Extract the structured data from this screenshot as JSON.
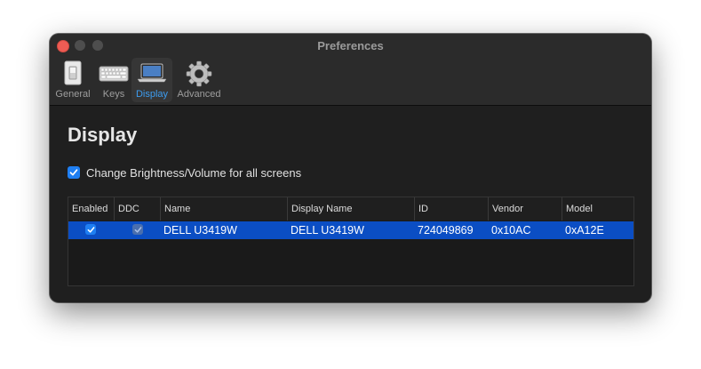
{
  "window": {
    "title": "Preferences"
  },
  "tabs": [
    {
      "label": "General",
      "icon": "light-switch-icon"
    },
    {
      "label": "Keys",
      "icon": "keyboard-icon"
    },
    {
      "label": "Display",
      "icon": "laptop-display-icon",
      "selected": true
    },
    {
      "label": "Advanced",
      "icon": "gear-icon"
    }
  ],
  "content": {
    "heading": "Display",
    "brightness_checkbox": {
      "label": "Change Brightness/Volume for all screens",
      "checked": true
    }
  },
  "table": {
    "columns": [
      "Enabled",
      "DDC",
      "Name",
      "Display Name",
      "ID",
      "Vendor",
      "Model"
    ],
    "rows": [
      {
        "enabled": true,
        "ddc": true,
        "name": "DELL U3419W",
        "display_name": "DELL U3419W",
        "id": "724049869",
        "vendor": "0x10AC",
        "model": "0xA12E",
        "selected": true
      }
    ]
  },
  "colors": {
    "accent": "#1f7ff2",
    "selection": "#0b4ec4",
    "selected_tab_label": "#3d9df0",
    "close_button": "#ee5c54"
  }
}
